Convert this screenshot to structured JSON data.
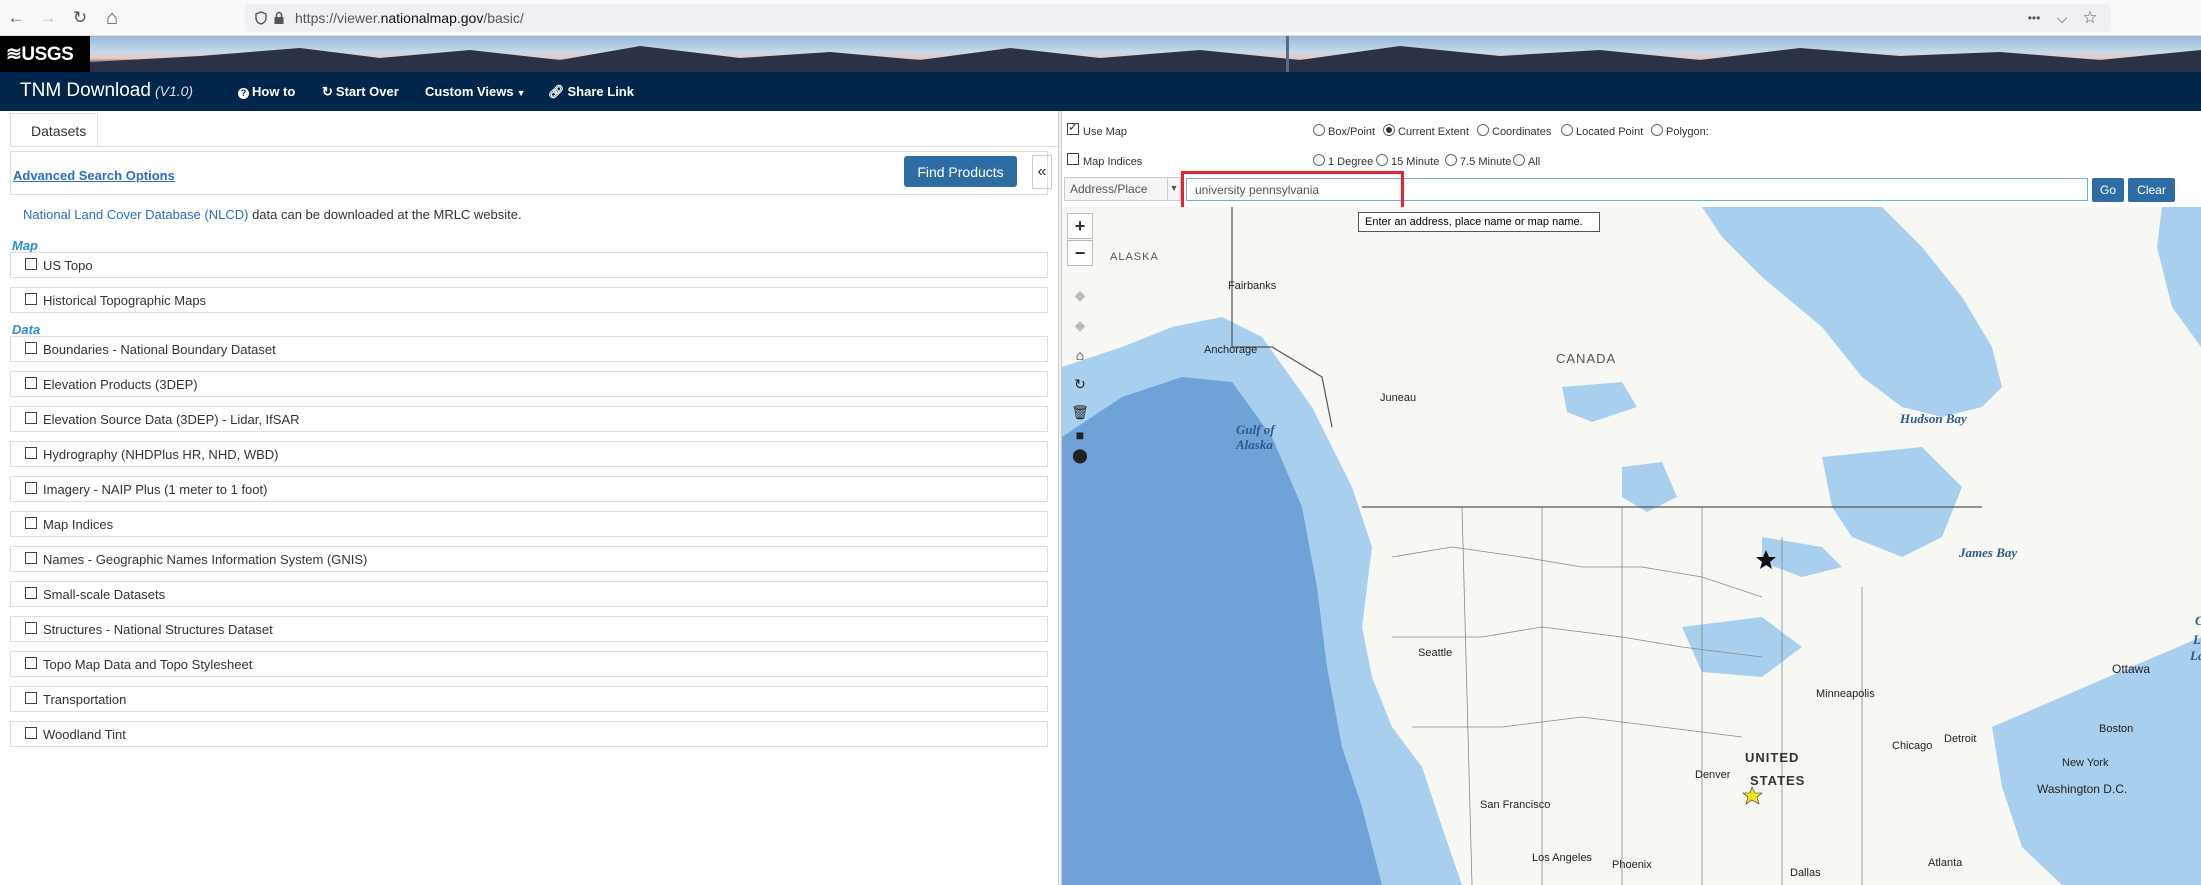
{
  "browser": {
    "url_prefix": "https://viewer.",
    "url_domain": "nationalmap.gov",
    "url_path": "/basic/",
    "back_icon": "←",
    "forward_icon": "→",
    "reload_icon": "↻",
    "home_icon": "⌂",
    "menu_icon": "•••",
    "pocket_icon": "⌵",
    "star_icon": "☆"
  },
  "banner": {
    "logo": "≋USGS"
  },
  "app_nav": {
    "title": "TNM Download",
    "version": "(V1.0)",
    "how_to": "How to",
    "start_over": "Start Over",
    "custom_views": "Custom Views",
    "share_link": "Share Link"
  },
  "left": {
    "tab": "Datasets",
    "advanced_search": "Advanced Search Options",
    "find_products": "Find Products",
    "collapse": "«",
    "nlcd_link": "National Land Cover Database (NLCD)",
    "nlcd_rest": " data can be downloaded at the MRLC website.",
    "section_map": "Map",
    "section_data": "Data",
    "map_items": [
      "US Topo",
      "Historical Topographic Maps"
    ],
    "data_items": [
      "Boundaries - National Boundary Dataset",
      "Elevation Products (3DEP)",
      "Elevation Source Data (3DEP) - Lidar, IfSAR",
      "Hydrography (NHDPlus HR, NHD, WBD)",
      "Imagery - NAIP Plus (1 meter to 1 foot)",
      "Map Indices",
      "Names - Geographic Names Information System (GNIS)",
      "Small-scale Datasets",
      "Structures - National Structures Dataset",
      "Topo Map Data and Topo Stylesheet",
      "Transportation",
      "Woodland Tint"
    ]
  },
  "map_controls": {
    "use_map": "Use Map",
    "map_indices": "Map Indices",
    "extent_options": [
      "Box/Point",
      "Current Extent",
      "Coordinates",
      "Located Point",
      "Polygon:"
    ],
    "extent_selected": "Current Extent",
    "index_options": [
      "1 Degree",
      "15 Minute",
      "7.5 Minute",
      "All"
    ],
    "address_select": "Address/Place",
    "search_value": "university pennsylvania",
    "go": "Go",
    "clear": "Clear",
    "tooltip": "Enter an address, place name or map name."
  },
  "map": {
    "zoom_in": "+",
    "zoom_out": "−",
    "labels": {
      "alaska": "ALASKA",
      "fairbanks": "Fairbanks",
      "anchorage": "Anchorage",
      "juneau": "Juneau",
      "canada": "CANADA",
      "seattle": "Seattle",
      "minneapolis": "Minneapolis",
      "ottawa": "Ottawa",
      "boston": "Boston",
      "detroit": "Detroit",
      "chicago": "Chicago",
      "new_york": "New York",
      "washington": "Washington D.C.",
      "denver": "Denver",
      "san_francisco": "San Francisco",
      "los_angeles": "Los Angeles",
      "phoenix": "Phoenix",
      "atlanta": "Atlanta",
      "dallas": "Dallas",
      "united": "UNITED",
      "states": "STATES",
      "gulf_of": "Gulf of",
      "alaska_water": "Alaska",
      "hudson_bay": "Hudson Bay",
      "james_bay": "James Bay",
      "edge_l": "L",
      "edge_c": "C",
      "edge_la": "La"
    },
    "colors": {
      "land": "#f7f7f4",
      "water": "#a8cfee",
      "deep_water": "#6fa3d8",
      "border": "#555555"
    }
  }
}
